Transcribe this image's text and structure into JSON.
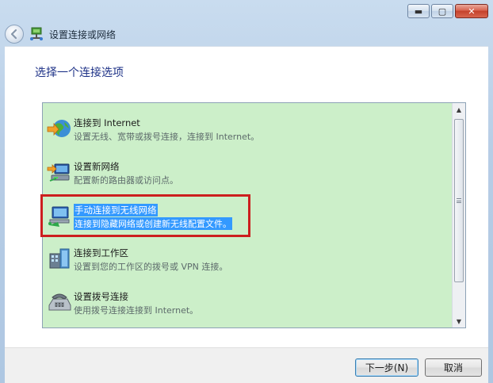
{
  "window": {
    "title": "设置连接或网络",
    "minimize_glyph": "▬",
    "maximize_glyph": "▢",
    "close_glyph": "✕"
  },
  "main": {
    "heading": "选择一个连接选项"
  },
  "options": [
    {
      "title": "连接到 Internet",
      "description": "设置无线、宽带或拨号连接，连接到 Internet。",
      "icon": "globe-icon",
      "selected": false
    },
    {
      "title": "设置新网络",
      "description": "配置新的路由器或访问点。",
      "icon": "router-icon",
      "selected": false
    },
    {
      "title": "手动连接到无线网络",
      "description": "连接到隐藏网络或创建新无线配置文件。",
      "icon": "wireless-network-icon",
      "selected": true
    },
    {
      "title": "连接到工作区",
      "description": "设置到您的工作区的拨号或 VPN 连接。",
      "icon": "workplace-icon",
      "selected": false
    },
    {
      "title": "设置拨号连接",
      "description": "使用拨号连接连接到 Internet。",
      "icon": "phone-modem-icon",
      "selected": false
    }
  ],
  "footer": {
    "next_label": "下一步(N)",
    "cancel_label": "取消"
  },
  "colors": {
    "list_background": "#ccefc9",
    "selection": "#3399ff",
    "highlight_border": "#cc1f1f",
    "heading": "#1e3287"
  }
}
